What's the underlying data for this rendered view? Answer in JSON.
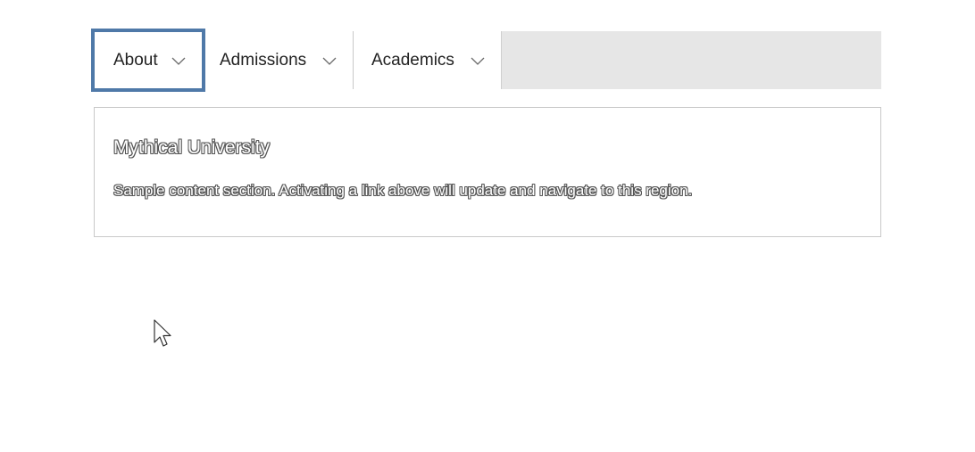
{
  "menubar": {
    "items": [
      {
        "label": "About",
        "focused": true
      },
      {
        "label": "Admissions",
        "focused": false
      },
      {
        "label": "Academics",
        "focused": false
      }
    ],
    "focus_ring_color": "#4f79a8",
    "bar_color": "#e6e6e6"
  },
  "content": {
    "title": "Mythical University",
    "body": "Sample content section. Activating a link above will update and navigate to this region."
  },
  "icons": {
    "submenu_indicator": "chevron-down-icon",
    "pointer": "mouse-cursor-icon"
  }
}
